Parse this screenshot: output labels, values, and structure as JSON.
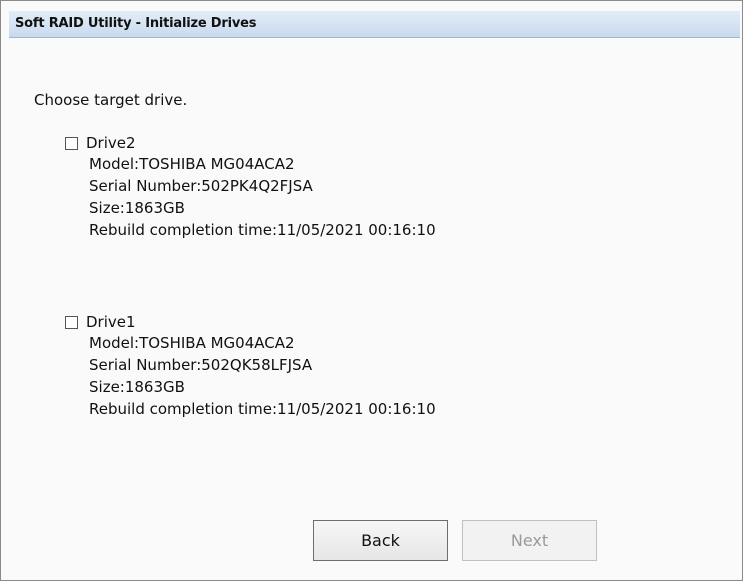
{
  "window": {
    "title": "Soft RAID Utility - Initialize Drives"
  },
  "prompt": "Choose target drive.",
  "drives": [
    {
      "name": "Drive2",
      "checked": false,
      "model": "Model:TOSHIBA MG04ACA2",
      "serial": "Serial Number:502PK4Q2FJSA",
      "size": "Size:1863GB",
      "rebuild": "Rebuild completion time:11/05/2021 00:16:10"
    },
    {
      "name": "Drive1",
      "checked": false,
      "model": "Model:TOSHIBA MG04ACA2",
      "serial": "Serial Number:502QK58LFJSA",
      "size": "Size:1863GB",
      "rebuild": "Rebuild completion time:11/05/2021 00:16:10"
    }
  ],
  "buttons": {
    "back_label": "Back",
    "next_label": "Next",
    "next_enabled": false
  },
  "colors": {
    "titlebar": "#d6e4f3",
    "disabled_text": "#9a9a9a"
  }
}
